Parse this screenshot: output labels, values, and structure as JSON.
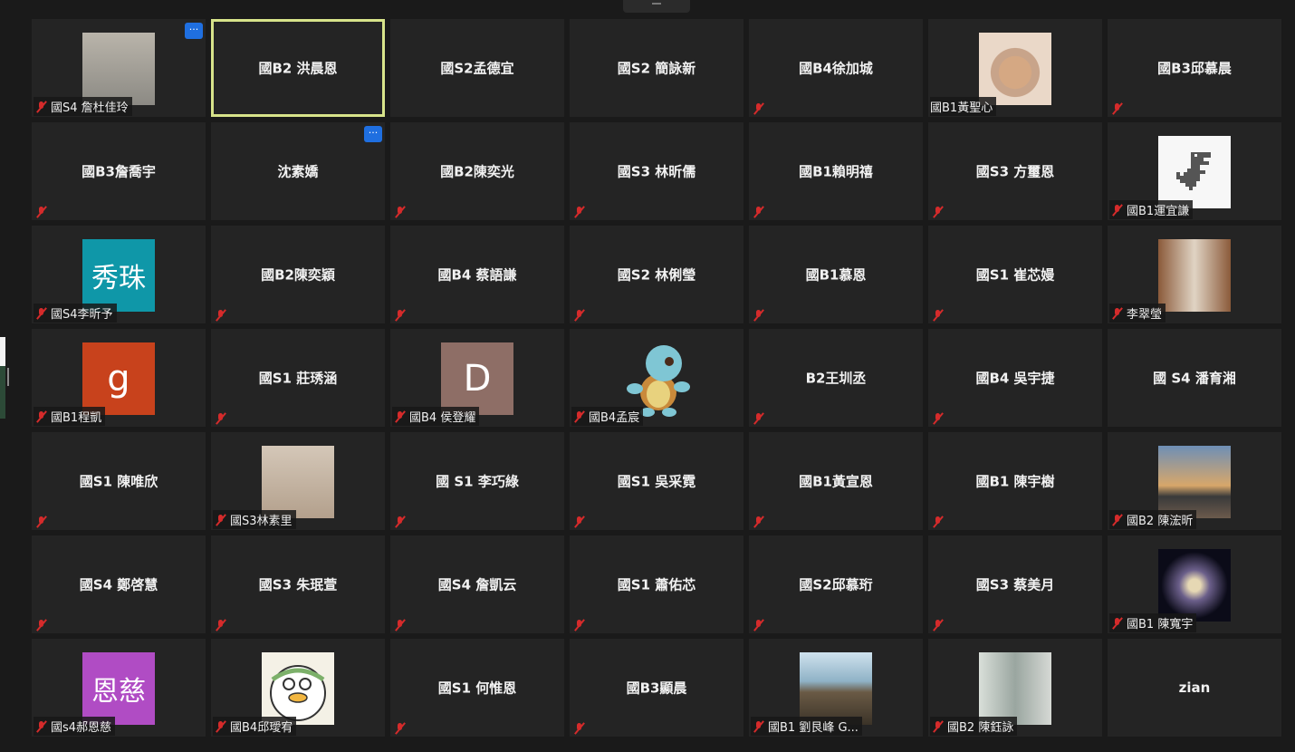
{
  "colors": {
    "background": "#1a1a1a",
    "tile": "#242424",
    "active_border": "#d7e38a",
    "more_button": "#1f6fe0",
    "muted_mic": "#d52b2b"
  },
  "more_label": "···",
  "participants": [
    {
      "label": "國S4 詹杜佳玲",
      "avatar": "photo",
      "center": "",
      "muted": true,
      "more": true
    },
    {
      "label": "",
      "avatar": "",
      "center": "國B2 洪晨恩",
      "muted": false,
      "active": true
    },
    {
      "label": "",
      "avatar": "",
      "center": "國S2孟德宜",
      "muted": false
    },
    {
      "label": "",
      "avatar": "",
      "center": "國S2 簡詠新",
      "muted": false
    },
    {
      "label": "",
      "avatar": "",
      "center": "國B4徐加城",
      "muted": true
    },
    {
      "label": "國B1黃聖心",
      "avatar": "rabbit",
      "center": "",
      "muted": false
    },
    {
      "label": "",
      "avatar": "",
      "center": "國B3邱慕晨",
      "muted": true
    },
    {
      "label": "",
      "avatar": "",
      "center": "國B3詹喬宇",
      "muted": true
    },
    {
      "label": "",
      "avatar": "",
      "center": "沈素嬌",
      "muted": false,
      "more": true
    },
    {
      "label": "",
      "avatar": "",
      "center": "國B2陳奕光",
      "muted": true
    },
    {
      "label": "",
      "avatar": "",
      "center": "國S3 林昕儒",
      "muted": true
    },
    {
      "label": "",
      "avatar": "",
      "center": "國B1賴明禧",
      "muted": true
    },
    {
      "label": "",
      "avatar": "",
      "center": "國S3 方璽恩",
      "muted": true
    },
    {
      "label": "國B1運宜謙",
      "avatar": "dino",
      "center": "",
      "muted": true
    },
    {
      "label": "國S4李昕予",
      "avatar": "text",
      "avatar_text": "秀珠",
      "avatar_color": "#0f97a8",
      "center": "",
      "muted": true
    },
    {
      "label": "",
      "avatar": "",
      "center": "國B2陳奕穎",
      "muted": true
    },
    {
      "label": "",
      "avatar": "",
      "center": "國B4 蔡語謙",
      "muted": true
    },
    {
      "label": "",
      "avatar": "",
      "center": "國S2 林俐瑩",
      "muted": true
    },
    {
      "label": "",
      "avatar": "",
      "center": "國B1慕恩",
      "muted": true
    },
    {
      "label": "",
      "avatar": "",
      "center": "國S1 崔芯嫚",
      "muted": true
    },
    {
      "label": "李翠瑩",
      "avatar": "teacher",
      "center": "",
      "muted": true
    },
    {
      "label": "國B1程凱",
      "avatar": "text",
      "avatar_text": "g",
      "avatar_color": "#c8421c",
      "center": "",
      "muted": true
    },
    {
      "label": "",
      "avatar": "",
      "center": "國S1 莊琇涵",
      "muted": true
    },
    {
      "label": "國B4 侯登耀",
      "avatar": "text",
      "avatar_text": "D",
      "avatar_color": "#8e6e66",
      "center": "",
      "muted": true
    },
    {
      "label": "國B4孟宸",
      "avatar": "squirtle",
      "center": "",
      "muted": true
    },
    {
      "label": "",
      "avatar": "",
      "center": "B2王圳丞",
      "muted": true
    },
    {
      "label": "",
      "avatar": "",
      "center": "國B4 吳宇捷",
      "muted": true
    },
    {
      "label": "",
      "avatar": "",
      "center": "國 S4 潘育湘",
      "muted": false
    },
    {
      "label": "",
      "avatar": "",
      "center": "國S1 陳唯欣",
      "muted": true
    },
    {
      "label": "國S3林素里",
      "avatar": "room",
      "center": "",
      "muted": true
    },
    {
      "label": "",
      "avatar": "",
      "center": "國 S1 李巧綠",
      "muted": true
    },
    {
      "label": "",
      "avatar": "",
      "center": "國S1 吳采霓",
      "muted": true
    },
    {
      "label": "",
      "avatar": "",
      "center": "國B1黃宣恩",
      "muted": true
    },
    {
      "label": "",
      "avatar": "",
      "center": "國B1 陳宇樹",
      "muted": true
    },
    {
      "label": "國B2 陳浤昕",
      "avatar": "sunset",
      "center": "",
      "muted": true
    },
    {
      "label": "",
      "avatar": "",
      "center": "國S4 鄭啓慧",
      "muted": true
    },
    {
      "label": "",
      "avatar": "",
      "center": "國S3 朱珉萱",
      "muted": true
    },
    {
      "label": "",
      "avatar": "",
      "center": "國S4 詹凱云",
      "muted": true
    },
    {
      "label": "",
      "avatar": "",
      "center": "國S1 蕭佑芯",
      "muted": true
    },
    {
      "label": "",
      "avatar": "",
      "center": "國S2邱慕珩",
      "muted": true
    },
    {
      "label": "",
      "avatar": "",
      "center": "國S3 蔡美月",
      "muted": true
    },
    {
      "label": "國B1 陳寬宇",
      "avatar": "galaxy",
      "center": "",
      "muted": true
    },
    {
      "label": "國s4郝恩慈",
      "avatar": "text",
      "avatar_text": "恩慈",
      "avatar_color": "#b04cc4",
      "center": "",
      "muted": true
    },
    {
      "label": "國B4邱璦宥",
      "avatar": "duck",
      "center": "",
      "muted": true
    },
    {
      "label": "",
      "avatar": "",
      "center": "國S1 何惟恩",
      "muted": true
    },
    {
      "label": "",
      "avatar": "",
      "center": "國B3顯晨",
      "muted": true
    },
    {
      "label": "國B1 劉艮峰 G...",
      "avatar": "coast",
      "center": "",
      "muted": true
    },
    {
      "label": "國B2 陳鈺詠",
      "avatar": "masked",
      "center": "",
      "muted": true
    },
    {
      "label": "",
      "avatar": "",
      "center": "zian",
      "muted": false
    }
  ]
}
